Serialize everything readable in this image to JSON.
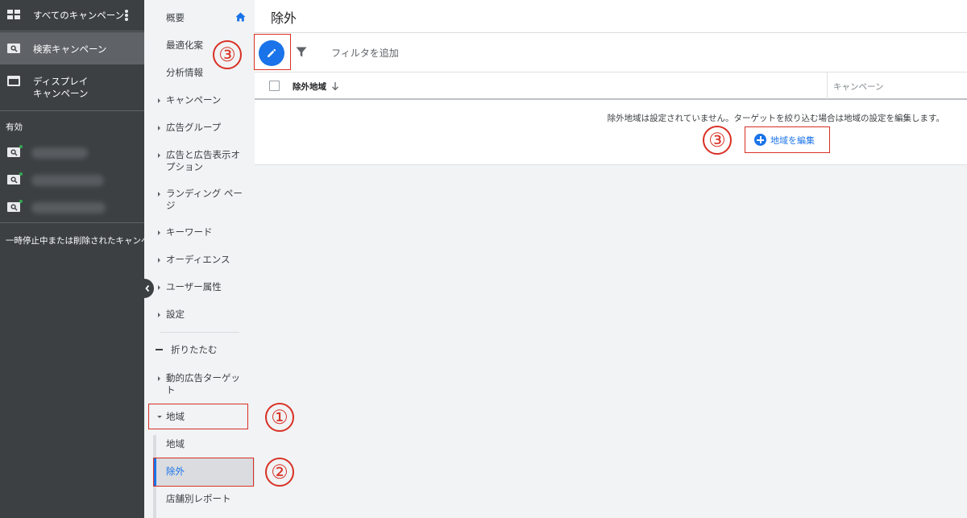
{
  "sidebar": {
    "all_campaigns": "すべてのキャンペーン",
    "search_campaign": "検索キャンペーン",
    "display_campaign_line1": "ディスプレイ",
    "display_campaign_line2": "キャンペーン",
    "enabled_label": "有効",
    "campaigns": [
      {
        "icon": "search-campaign-icon",
        "status": "enabled"
      },
      {
        "icon": "search-campaign-icon",
        "status": "enabled"
      },
      {
        "icon": "search-campaign-icon",
        "status": "enabled"
      }
    ],
    "paused_removed": "一時停止中または削除されたキャンペー"
  },
  "nav": {
    "overview": "概要",
    "recommendations": "最適化案",
    "insights": "分析情報",
    "campaigns": "キャンペーン",
    "ad_groups": "広告グループ",
    "ads_extensions": "広告と広告表示オプション",
    "landing_pages": "ランディング ページ",
    "keywords": "キーワード",
    "audiences": "オーディエンス",
    "demographics": "ユーザー属性",
    "settings": "設定",
    "collapse": "折りたたむ",
    "dynamic_ad_targets": "動的広告ターゲット",
    "locations": "地域",
    "locations_sub": "地域",
    "exclusions": "除外",
    "store_report": "店舗別レポート"
  },
  "main": {
    "title": "除外",
    "filter_placeholder": "フィルタを追加",
    "table": {
      "col_excluded_locations": "除外地域",
      "col_campaign": "キャンペーン"
    },
    "empty_message": "除外地域は設定されていません。ターゲットを絞り込む場合は地域の設定を編集します。",
    "edit_locations_button": "地域を編集"
  },
  "annotations": {
    "marker_1": "①",
    "marker_2": "②",
    "marker_3a": "③",
    "marker_3b": "③"
  },
  "colors": {
    "sidebar_bg": "#3c4043",
    "nav_bg": "#f1f3f4",
    "accent_blue": "#1a73e8",
    "annotation_red": "#d93025",
    "enabled_dot": "#34a853"
  }
}
